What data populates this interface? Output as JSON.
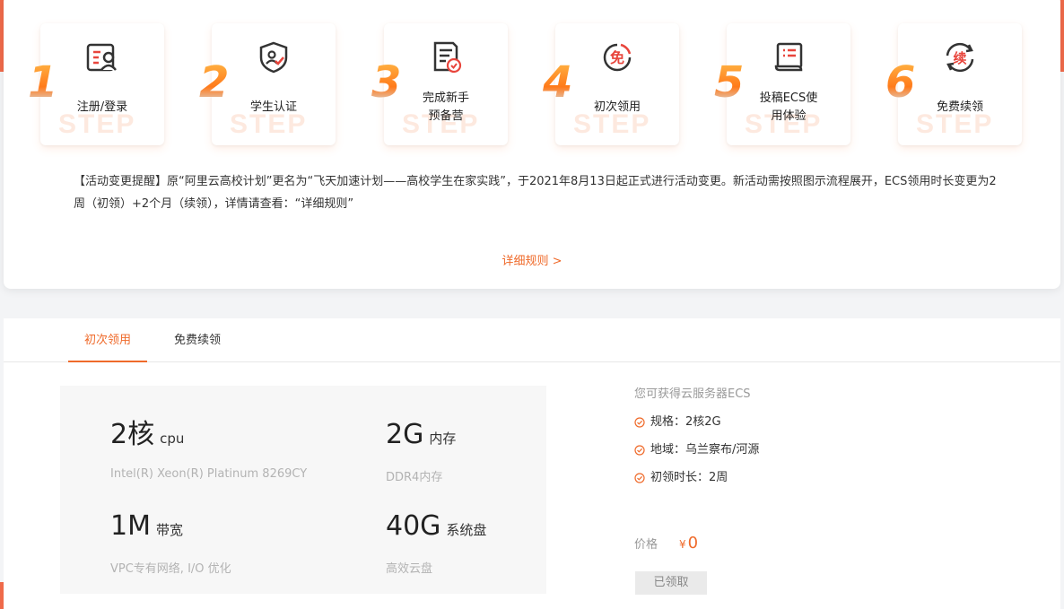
{
  "steps": [
    {
      "num": "1",
      "label": "注册/登录",
      "watermark": "STEP",
      "icon": "user-card-icon"
    },
    {
      "num": "2",
      "label": "学生认证",
      "watermark": "STEP",
      "icon": "shield-check-icon"
    },
    {
      "num": "3",
      "label": "完成新手\n预备营",
      "watermark": "STEP",
      "icon": "document-check-icon"
    },
    {
      "num": "4",
      "label": "初次领用",
      "watermark": "STEP",
      "icon": "free-badge-icon"
    },
    {
      "num": "5",
      "label": "投稿ECS使\n用体验",
      "watermark": "STEP",
      "icon": "scroll-icon"
    },
    {
      "num": "6",
      "label": "免费续领",
      "watermark": "STEP",
      "icon": "renew-icon"
    }
  ],
  "icon_text": {
    "free": "免",
    "renew": "续"
  },
  "notice": "【活动变更提醒】原“阿里云高校计划”更名为“飞天加速计划——高校学生在家实践”，于2021年8月13日起正式进行活动变更。新活动需按照图示流程展开，ECS领用时长变更为2周（初领）+2个月（续领），详情请查看：“详细规则”",
  "detail_link": "详细规则 >",
  "tabs": [
    {
      "label": "初次领用",
      "active": true
    },
    {
      "label": "免费续领",
      "active": false
    }
  ],
  "specs": {
    "cpu": {
      "value": "2核",
      "unit": "cpu",
      "sub": "Intel(R) Xeon(R) Platinum 8269CY"
    },
    "memory": {
      "value": "2G",
      "unit": "内存",
      "sub": "DDR4内存"
    },
    "bandwidth": {
      "value": "1M",
      "unit": "带宽",
      "sub": "VPC专有网络, I/O 优化"
    },
    "disk": {
      "value": "40G",
      "unit": "系统盘",
      "sub": "高效云盘"
    }
  },
  "info": {
    "title": "您可获得云服务器ECS",
    "items": [
      "规格：2核2G",
      "地域：乌兰察布/河源",
      "初领时长：2周"
    ]
  },
  "price": {
    "label": "价格",
    "currency": "¥",
    "value": "0"
  },
  "claimed_button": "已领取",
  "colors": {
    "accent": "#ef6a2a",
    "icon_red": "#e8453c",
    "icon_dark": "#333333"
  }
}
